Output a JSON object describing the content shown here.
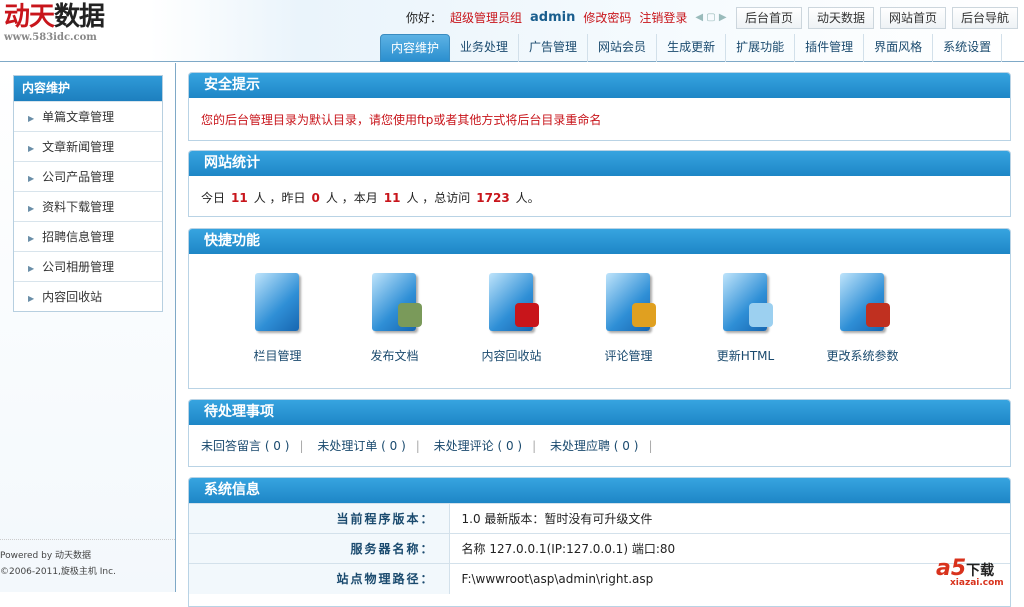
{
  "header": {
    "logo_red": "动天",
    "logo_black": "数据",
    "logo_url": "www.583idc.com",
    "greeting": "你好：",
    "role": "超级管理员组",
    "user": "admin",
    "change_pwd": "修改密码",
    "logout": "注销登录",
    "top_buttons": [
      "后台首页",
      "动天数据",
      "网站首页",
      "后台导航"
    ],
    "tabs": [
      "内容维护",
      "业务处理",
      "广告管理",
      "网站会员",
      "生成更新",
      "扩展功能",
      "插件管理",
      "界面风格",
      "系统设置"
    ]
  },
  "sidebar": {
    "title": "内容维护",
    "items": [
      "单篇文章管理",
      "文章新闻管理",
      "公司产品管理",
      "资料下载管理",
      "招聘信息管理",
      "公司相册管理",
      "内容回收站"
    ],
    "footer1": "Powered by 动天数据",
    "footer2": "©2006-2011,旋极主机 Inc."
  },
  "security": {
    "title": "安全提示",
    "message": "您的后台管理目录为默认目录，请您使用ftp或者其他方式将后台目录重命名"
  },
  "stats": {
    "title": "网站统计",
    "today_label": "今日",
    "today": "11",
    "yesterday_label": "人 ，昨日",
    "yesterday": "0",
    "month_label": "人 ，本月",
    "month": "11",
    "total_label": "人 ，总访问",
    "total": "1723",
    "end": "人。"
  },
  "quick": {
    "title": "快捷功能",
    "items": [
      {
        "label": "栏目管理",
        "icon": "column-folder-icon",
        "color": ""
      },
      {
        "label": "发布文档",
        "icon": "publish-document-icon",
        "color": "#7a9a5a"
      },
      {
        "label": "内容回收站",
        "icon": "recycle-bin-icon",
        "color": "#c8151b"
      },
      {
        "label": "评论管理",
        "icon": "comment-pen-icon",
        "color": "#e0a020"
      },
      {
        "label": "更新HTML",
        "icon": "update-html-globe-icon",
        "color": "#9cd0f0"
      },
      {
        "label": "更改系统参数",
        "icon": "system-tools-icon",
        "color": "#c03020"
      }
    ]
  },
  "pending": {
    "title": "待处理事项",
    "items": [
      "未回答留言 ( 0 )",
      "未处理订单 ( 0 )",
      "未处理评论 ( 0 )",
      "未处理应聘 ( 0 )"
    ]
  },
  "sysinfo": {
    "title": "系统信息",
    "rows": [
      {
        "k": "当前程序版本：",
        "v": "1.0 最新版本：暂时没有可升级文件"
      },
      {
        "k": "服务器名称：",
        "v": "名称  127.0.0.1(IP:127.0.0.1) 端口:80"
      },
      {
        "k": "站点物理路径：",
        "v": "F:\\wwwroot\\asp\\admin\\right.asp"
      }
    ]
  },
  "watermark": {
    "brand": "a5",
    "text": "下载",
    "url": "xiazai.com"
  }
}
